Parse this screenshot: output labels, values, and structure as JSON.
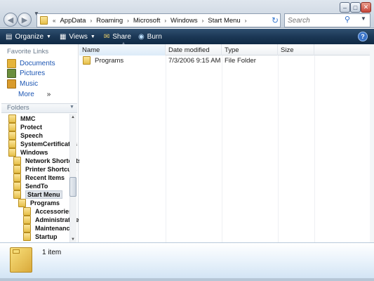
{
  "window": {
    "minimize_glyph": "–",
    "maximize_glyph": "□",
    "close_glyph": "✕"
  },
  "address": {
    "overflow_glyph": "«",
    "separator_glyph": "›",
    "crumbs": [
      "AppData",
      "Roaming",
      "Microsoft",
      "Windows",
      "Start Menu"
    ]
  },
  "search": {
    "placeholder": "Search"
  },
  "toolbar": {
    "organize": "Organize",
    "views": "Views",
    "share": "Share",
    "burn": "Burn",
    "help": "?"
  },
  "nav": {
    "favorites_title": "Favorite Links",
    "favorites": [
      {
        "label": "Documents",
        "color": "#e5b43b"
      },
      {
        "label": "Pictures",
        "color": "#6b8e3d"
      },
      {
        "label": "Music",
        "color": "#d99b2b"
      }
    ],
    "more": "More",
    "more_glyph": "»",
    "folders_title": "Folders",
    "tree": [
      {
        "label": "MMC",
        "depth": 0,
        "selected": false
      },
      {
        "label": "Protect",
        "depth": 0,
        "selected": false
      },
      {
        "label": "Speech",
        "depth": 0,
        "selected": false
      },
      {
        "label": "SystemCertificates",
        "depth": 0,
        "selected": false
      },
      {
        "label": "Windows",
        "depth": 0,
        "selected": false
      },
      {
        "label": "Network Shortcuts",
        "depth": 1,
        "selected": false
      },
      {
        "label": "Printer Shortcuts",
        "depth": 1,
        "selected": false
      },
      {
        "label": "Recent Items",
        "depth": 1,
        "selected": false
      },
      {
        "label": "SendTo",
        "depth": 1,
        "selected": false
      },
      {
        "label": "Start Menu",
        "depth": 1,
        "selected": true
      },
      {
        "label": "Programs",
        "depth": 2,
        "selected": false
      },
      {
        "label": "Accessories",
        "depth": 3,
        "selected": false
      },
      {
        "label": "Administrative",
        "depth": 3,
        "selected": false
      },
      {
        "label": "Maintenance",
        "depth": 3,
        "selected": false
      },
      {
        "label": "Startup",
        "depth": 3,
        "selected": false
      }
    ]
  },
  "filelist": {
    "columns": {
      "name": "Name",
      "date": "Date modified",
      "type": "Type",
      "size": "Size"
    },
    "rows": [
      {
        "name": "Programs",
        "date": "7/3/2006 9:15 AM",
        "type": "File Folder",
        "size": ""
      }
    ]
  },
  "details": {
    "count": "1 item"
  },
  "colors": {
    "accent": "#1c3856",
    "link": "#1b55b3"
  }
}
